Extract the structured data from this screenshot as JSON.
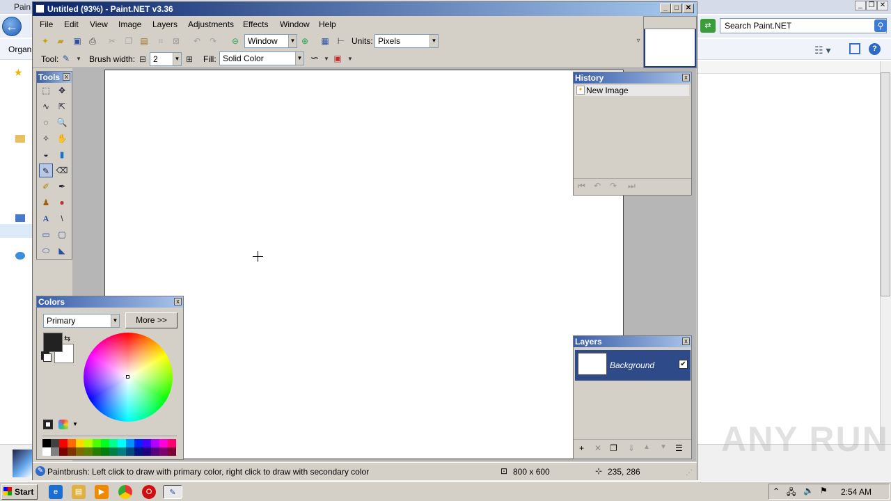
{
  "background_window": {
    "title": "Pain",
    "search_placeholder": "Search Paint.NET",
    "organize_label": "Organi",
    "ctrl_min": "_",
    "ctrl_max": "❐",
    "ctrl_close": "✕",
    "back_glyph": "←",
    "search_glyph": "⚲",
    "help_glyph": "?"
  },
  "window": {
    "title": "Untitled (93%) - Paint.NET v3.36",
    "min_label": "_",
    "max_label": "□",
    "close_label": "✕"
  },
  "menu": [
    "File",
    "Edit",
    "View",
    "Image",
    "Layers",
    "Adjustments",
    "Effects",
    "Window",
    "Help"
  ],
  "toolbar": {
    "zoom_value": "Window",
    "units_label": "Units:",
    "units_value": "Pixels",
    "tool_label": "Tool:",
    "brush_width_label": "Brush width:",
    "brush_width_value": "2",
    "fill_label": "Fill:",
    "fill_value": "Solid Color",
    "icons": [
      "new-icon",
      "open-icon",
      "save-icon",
      "print-icon",
      "cut-icon",
      "copy-icon",
      "paste-icon",
      "crop-icon",
      "deselect-icon",
      "undo-icon",
      "redo-icon",
      "zoom-out-icon",
      "zoom-in-icon",
      "grid-icon",
      "rulers-icon"
    ]
  },
  "tools_panel": {
    "title": "Tools",
    "close_label": "x",
    "tools": [
      "rectangle-select",
      "move-selection",
      "lasso-select",
      "move-selected",
      "ellipse-select",
      "zoom",
      "magic-wand",
      "pan",
      "paint-bucket",
      "gradient",
      "paintbrush",
      "eraser",
      "pencil",
      "color-picker",
      "clone-stamp",
      "recolor",
      "text",
      "line-curve",
      "rectangle",
      "rounded-rectangle",
      "ellipse",
      "freeform-shape"
    ],
    "glyphs": [
      "⬚",
      "✥",
      "∿",
      "⇱",
      "◌",
      "🔍",
      "✧",
      "✋",
      "◒",
      "▮",
      "✎",
      "⌫",
      "✐",
      "✒",
      "♟",
      "●",
      "A",
      "\\",
      "▭",
      "▢",
      "⬭",
      "◣"
    ],
    "selected": "paintbrush"
  },
  "history_panel": {
    "title": "History",
    "close_label": "x",
    "items": [
      "New Image"
    ],
    "nav": [
      "⏮",
      "↶",
      "↷",
      "⏭"
    ]
  },
  "layers_panel": {
    "title": "Layers",
    "close_label": "x",
    "layers": [
      {
        "name": "Background",
        "visible": true
      }
    ],
    "actions": [
      "add-layer",
      "delete-layer",
      "duplicate-layer",
      "merge-down",
      "move-up",
      "move-down",
      "layer-properties"
    ],
    "action_glyphs": [
      "+",
      "✕",
      "❐",
      "⇓",
      "▲",
      "▼",
      "☰"
    ]
  },
  "colors_panel": {
    "title": "Colors",
    "close_label": "x",
    "mode": "Primary",
    "more_button": "More >>",
    "primary_color": "#222222",
    "secondary_color": "#ffffff",
    "palette_top": [
      "#000000",
      "#404040",
      "#ff0000",
      "#ff6a00",
      "#ffd800",
      "#b6ff00",
      "#4cff00",
      "#00ff21",
      "#00ff90",
      "#00ffff",
      "#0094ff",
      "#0026ff",
      "#4800ff",
      "#b200ff",
      "#ff00dc",
      "#ff006e"
    ],
    "palette_bottom": [
      "#ffffff",
      "#808080",
      "#7f0000",
      "#7f3300",
      "#7f6a00",
      "#5b7f00",
      "#267f00",
      "#007f0e",
      "#007f46",
      "#007f7f",
      "#004a7f",
      "#00137f",
      "#21007f",
      "#57007f",
      "#7f006e",
      "#7f0037"
    ]
  },
  "status_bar": {
    "message": "Paintbrush: Left click to draw with primary color, right click to draw with secondary color",
    "image_size": "800 x 600",
    "cursor_pos": "235, 286"
  },
  "taskbar": {
    "start_label": "Start",
    "clock": "2:54 AM",
    "apps": [
      "ie-icon",
      "explorer-icon",
      "media-player-icon",
      "chrome-icon",
      "opera-icon",
      "paintnet-icon"
    ],
    "tray_up": "⌃"
  },
  "watermark": "ANY RUN"
}
